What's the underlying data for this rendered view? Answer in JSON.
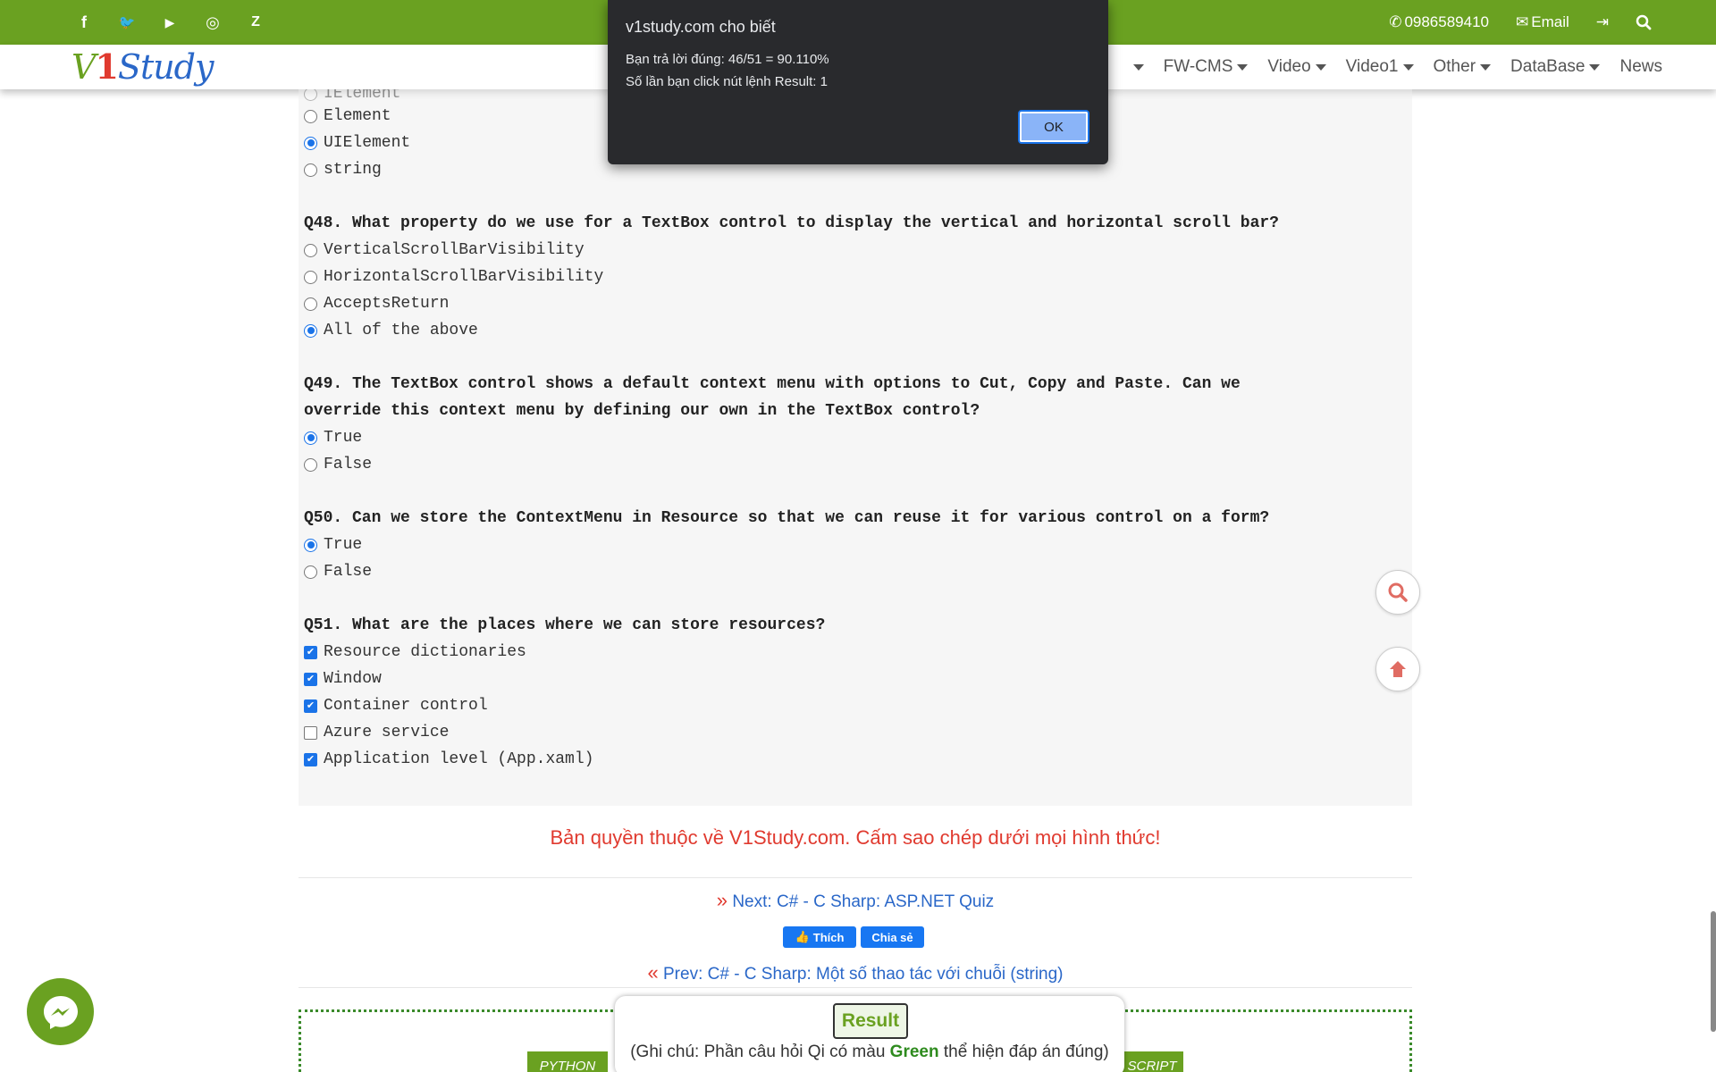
{
  "topbar": {
    "social": [
      {
        "icon": "facebook-icon",
        "glyph": "f"
      },
      {
        "icon": "twitter-icon",
        "glyph": "🐦"
      },
      {
        "icon": "youtube-icon",
        "glyph": "▶"
      },
      {
        "icon": "instagram-icon",
        "glyph": "◎"
      },
      {
        "icon": "zalo-icon",
        "glyph": "Z"
      }
    ],
    "phone": "0986589410",
    "email": "Email"
  },
  "logo": {
    "v": "V",
    "one": "1",
    "rest": "Study"
  },
  "menu": {
    "items": [
      {
        "label": "FW-CMS"
      },
      {
        "label": "Video"
      },
      {
        "label": "Video1"
      },
      {
        "label": "Other"
      },
      {
        "label": "DataBase"
      },
      {
        "label": "News"
      }
    ]
  },
  "quiz": {
    "q47_options": [
      "IElement",
      "Element",
      "UIElement",
      "string"
    ],
    "q48": {
      "question": "Q48. What property do we use for a TextBox control to display the vertical and horizontal scroll bar?",
      "options": [
        "VerticalScrollBarVisibility",
        "HorizontalScrollBarVisibility",
        "AcceptsReturn",
        "All of the above"
      ]
    },
    "q49": {
      "question_line1": "Q49. The TextBox control shows a default context menu with options to Cut, Copy and Paste. Can we",
      "question_line2": "override this context menu by defining our own in the TextBox control?",
      "options": [
        "True",
        "False"
      ]
    },
    "q50": {
      "question": "Q50. Can we store the ContextMenu in Resource so that we can reuse it for various control on a form?",
      "options": [
        "True",
        "False"
      ]
    },
    "q51": {
      "question": "Q51. What are the places where we can store resources?",
      "options": [
        "Resource dictionaries",
        "Window",
        "Container control",
        "Azure service",
        "Application level (App.xaml)"
      ]
    }
  },
  "footer": {
    "copyright": "Bản quyền thuộc về V1Study.com. Cấm sao chép dưới mọi hình thức!",
    "next_link": "Next: C# - C Sharp: ASP.NET Quiz",
    "prev_link": "Prev: C# - C Sharp: Một số thao tác với chuỗi (string)",
    "like_label": "Thích",
    "share_label": "Chia sẻ",
    "btn_python": "PYTHON",
    "btn_script": "SCRIPT"
  },
  "result": {
    "button": "Result",
    "note_before": "(Ghi chú: Phần câu hỏi Qi có màu ",
    "note_green": "Green",
    "note_after": " thể hiện đáp án đúng)"
  },
  "alert": {
    "title": "v1study.com cho biết",
    "line1": "Bạn trả lời đúng: 46/51 = 90.110%",
    "line2": "Số lần bạn click nút lệnh Result: 1",
    "ok": "OK"
  },
  "colors": {
    "brand_green": "#6aa121",
    "accent_blue": "#1a73e8",
    "red": "#e03a2f"
  }
}
